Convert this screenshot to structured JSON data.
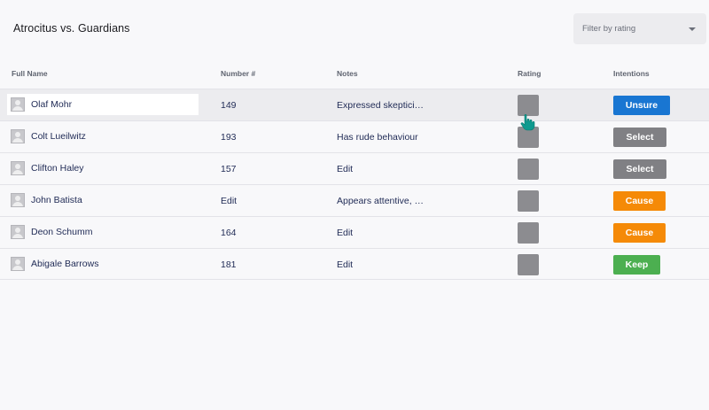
{
  "title": "Atrocitus vs. Guardians",
  "filter": {
    "label": "Filter by rating",
    "caret_icon": "chevron-down-icon"
  },
  "table": {
    "headers": {
      "name": "Full Name",
      "number": "Number #",
      "notes": "Notes",
      "rating": "Rating",
      "intentions": "Intentions"
    },
    "rows": [
      {
        "name": "Olaf Mohr",
        "number": "149",
        "notes": "Expressed skeptici…",
        "intention": "Unsure",
        "intention_color": "#1976d2",
        "highlighted": true
      },
      {
        "name": "Colt Lueilwitz",
        "number": "193",
        "notes": "Has rude behaviour",
        "intention": "Select",
        "intention_color": "#808084",
        "highlighted": false
      },
      {
        "name": "Clifton Haley",
        "number": "157",
        "notes": "Edit",
        "intention": "Select",
        "intention_color": "#808084",
        "highlighted": false
      },
      {
        "name": "John Batista",
        "number": "Edit",
        "notes": "Appears attentive, …",
        "intention": "Cause",
        "intention_color": "#f58a07",
        "highlighted": false
      },
      {
        "name": "Deon Schumm",
        "number": "164",
        "notes": "Edit",
        "intention": "Cause",
        "intention_color": "#f58a07",
        "highlighted": false
      },
      {
        "name": "Abigale Barrows",
        "number": "181",
        "notes": "Edit",
        "intention": "Keep",
        "intention_color": "#4caf50",
        "highlighted": false
      }
    ]
  },
  "rating_color": "#8c8c90",
  "cursor": {
    "icon": "hand-pointer-icon",
    "color": "#0f9a8f"
  }
}
